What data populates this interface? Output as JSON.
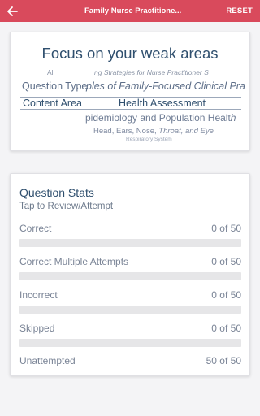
{
  "appbar": {
    "title": "Family Nurse Practitione...",
    "reset_label": "RESET",
    "background": "#d94a5c",
    "back_icon": "arrow-left-icon"
  },
  "focus": {
    "title": "Focus on your weak areas",
    "wheel": {
      "row1_left": "All",
      "row1_right": "ng Strategies for Nurse Practitioner S",
      "row2_left": "Question Type",
      "row2_right": "ples of Family-Focused Clinical Pra",
      "row3_left": "Content Area",
      "row3_right": "Health Assessment",
      "row4": "pidemiology and Population Healt",
      "row4_italic": "h",
      "row5_plain": "Head, Ears, Nose, ",
      "row5_italic": "Throat, and Eye",
      "row6": "Respiratory System"
    }
  },
  "stats": {
    "title": "Question Stats",
    "subtitle": "Tap to Review/Attempt",
    "rows": [
      {
        "label": "Correct",
        "value": "0 of 50",
        "fraction": 0,
        "has_bar": true
      },
      {
        "label": "Correct Multiple Attempts",
        "value": "0 of 50",
        "fraction": 0,
        "has_bar": true
      },
      {
        "label": "Incorrect",
        "value": "0 of 50",
        "fraction": 0,
        "has_bar": true
      },
      {
        "label": "Skipped",
        "value": "0 of 50",
        "fraction": 0,
        "has_bar": true
      },
      {
        "label": "Unattempted",
        "value": "50 of 50",
        "fraction": 1,
        "has_bar": false
      }
    ]
  }
}
